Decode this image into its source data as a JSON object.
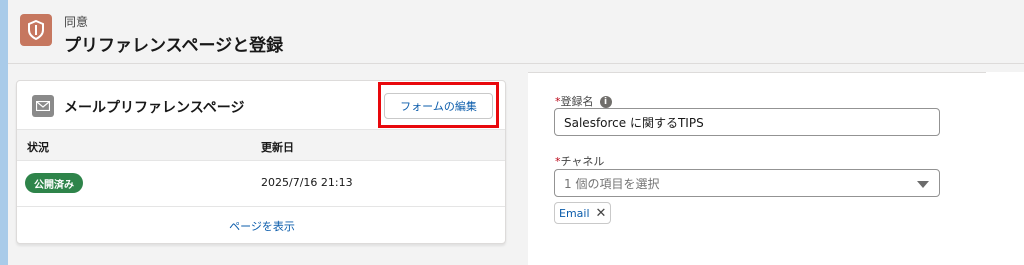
{
  "header": {
    "subtitle": "同意",
    "title": "プリファレンスページと登録"
  },
  "card": {
    "title": "メールプリファレンスページ",
    "edit_button": "フォームの編集",
    "columns": [
      "状況",
      "更新日"
    ],
    "row": {
      "status": "公開済み",
      "updated": "2025/7/16 21:13"
    },
    "view_link": "ページを表示"
  },
  "form": {
    "registration_name_label": "登録名",
    "registration_name_value": "Salesforce に関するTIPS",
    "channel_label": "チャネル",
    "channel_placeholder": "1 個の項目を選択",
    "selected_pill": "Email",
    "required_marker": "*",
    "info_glyph": "i"
  },
  "colors": {
    "header_icon": "#c6775f",
    "badge_green": "#2e844a",
    "link_blue": "#0b5cab",
    "highlight_red": "#e8080c"
  }
}
